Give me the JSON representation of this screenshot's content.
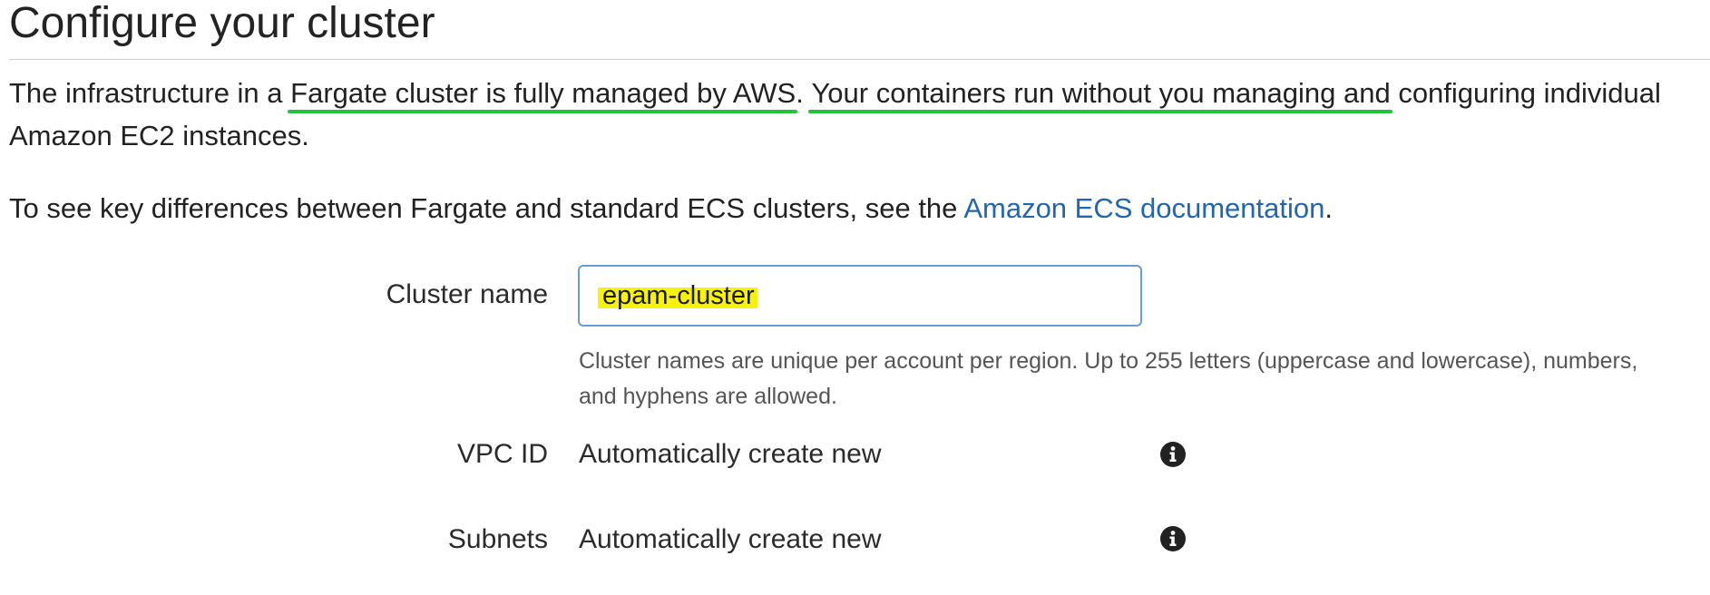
{
  "page_title": "Configure your cluster",
  "intro": {
    "line1_start": "The infrastructure in a ",
    "line1_highlight1": "Fargate cluster is fully managed by AWS",
    "line1_middle": ". ",
    "line1_highlight2": "Your containers run without you managing and",
    "line1_end": " configuring individual",
    "line2": "Amazon EC2 instances."
  },
  "doc_note": {
    "text_before": "To see key differences between Fargate and standard ECS clusters, see the ",
    "link_text": "Amazon ECS documentation",
    "text_after": "."
  },
  "form": {
    "cluster_name": {
      "label": "Cluster name",
      "value": "epam-cluster",
      "help_line1": "Cluster names are unique per account per region. Up to 255 letters (uppercase and lowercase), numbers,",
      "help_line2": "and hyphens are allowed."
    },
    "vpc_id": {
      "label": "VPC ID",
      "value": "Automatically create new",
      "icon": "info-icon"
    },
    "subnets": {
      "label": "Subnets",
      "value": "Automatically create new",
      "icon": "info-icon"
    }
  },
  "colors": {
    "link": "#1f66b3",
    "annotation_underline": "#22c33b",
    "text_highlight": "#f7f20a",
    "input_border": "#6c9ad6"
  }
}
